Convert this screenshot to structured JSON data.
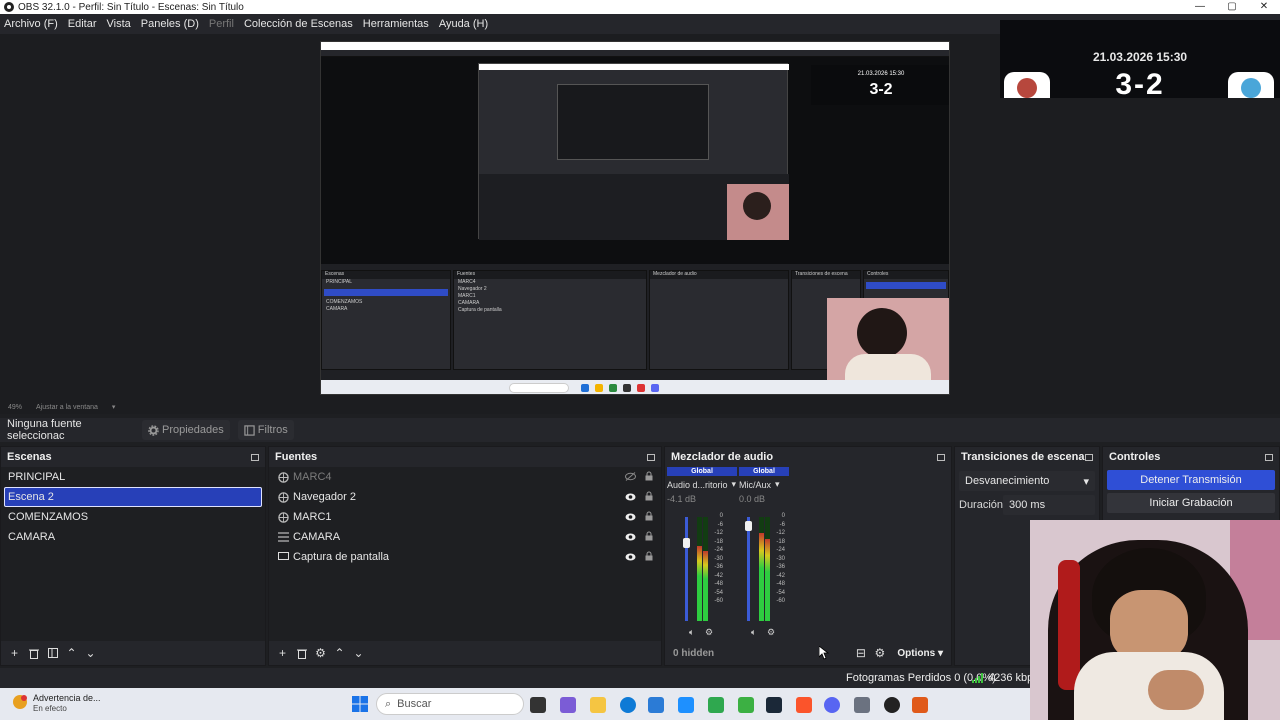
{
  "window": {
    "title": "OBS 32.1.0 - Perfil: Sin Título - Escenas: Sin Título"
  },
  "menu": [
    {
      "label": "Archivo (F)",
      "dim": false
    },
    {
      "label": "Editar",
      "dim": false
    },
    {
      "label": "Vista",
      "dim": false
    },
    {
      "label": "Paneles (D)",
      "dim": false
    },
    {
      "label": "Perfil",
      "dim": true
    },
    {
      "label": "Colección de Escenas",
      "dim": false
    },
    {
      "label": "Herramientas",
      "dim": false
    },
    {
      "label": "Ayuda (H)",
      "dim": false
    }
  ],
  "overlay": {
    "datetime": "21.03.2026 15:30",
    "score": "3-2"
  },
  "preview_footer": {
    "zoom": "49%",
    "fit": "Ajustar a la ventana"
  },
  "source_bar": {
    "no_selection": "Ninguna fuente seleccionac",
    "properties": "Propiedades",
    "filters": "Filtros"
  },
  "scenes": {
    "title": "Escenas",
    "items": [
      {
        "label": "PRINCIPAL",
        "selected": false
      },
      {
        "label": "Escena 2",
        "selected": true
      },
      {
        "label": "COMENZAMOS",
        "selected": false
      },
      {
        "label": "CAMARA",
        "selected": false
      }
    ]
  },
  "sources": {
    "title": "Fuentes",
    "items": [
      {
        "label": "MARC4",
        "type": "browser-icon",
        "visible": false
      },
      {
        "label": "Navegador 2",
        "type": "browser-icon",
        "visible": true
      },
      {
        "label": "MARC1",
        "type": "browser-icon",
        "visible": true
      },
      {
        "label": "CAMARA",
        "type": "list-icon",
        "visible": true
      },
      {
        "label": "Captura de pantalla",
        "type": "monitor-icon",
        "visible": true
      }
    ]
  },
  "mixer": {
    "title": "Mezclador de audio",
    "channels": [
      {
        "global": "Global",
        "name": "Audio d...ritorio",
        "db": "-4.1 dB",
        "level": 0.72,
        "volume": 0.8
      },
      {
        "global": "Global",
        "name": "Mic/Aux",
        "db": "0.0 dB",
        "level": 0.85,
        "volume": 0.96
      }
    ],
    "scale": [
      "0",
      "-6",
      "-12",
      "-18",
      "-24",
      "-30",
      "-36",
      "-42",
      "-48",
      "-54",
      "-60"
    ],
    "hidden": "0 hidden",
    "options": "Options"
  },
  "transitions": {
    "title": "Transiciones de escena",
    "transition": "Desvanecimiento",
    "duration_label": "Duración",
    "duration_value": "300 ms"
  },
  "controls": {
    "title": "Controles",
    "stop_stream": "Detener Transmisión",
    "start_record": "Iniciar Grabación"
  },
  "status": {
    "frames": "Fotogramas Perdidos 0 (0.0%)",
    "kbps": "4236 kbps"
  },
  "taskbar": {
    "warning_title": "Advertencia de...",
    "warning_sub": "En efecto",
    "search": "Buscar"
  },
  "colors": {
    "accent": "#2740b8",
    "panel": "#25262b",
    "list_bg": "#1e1f22"
  }
}
